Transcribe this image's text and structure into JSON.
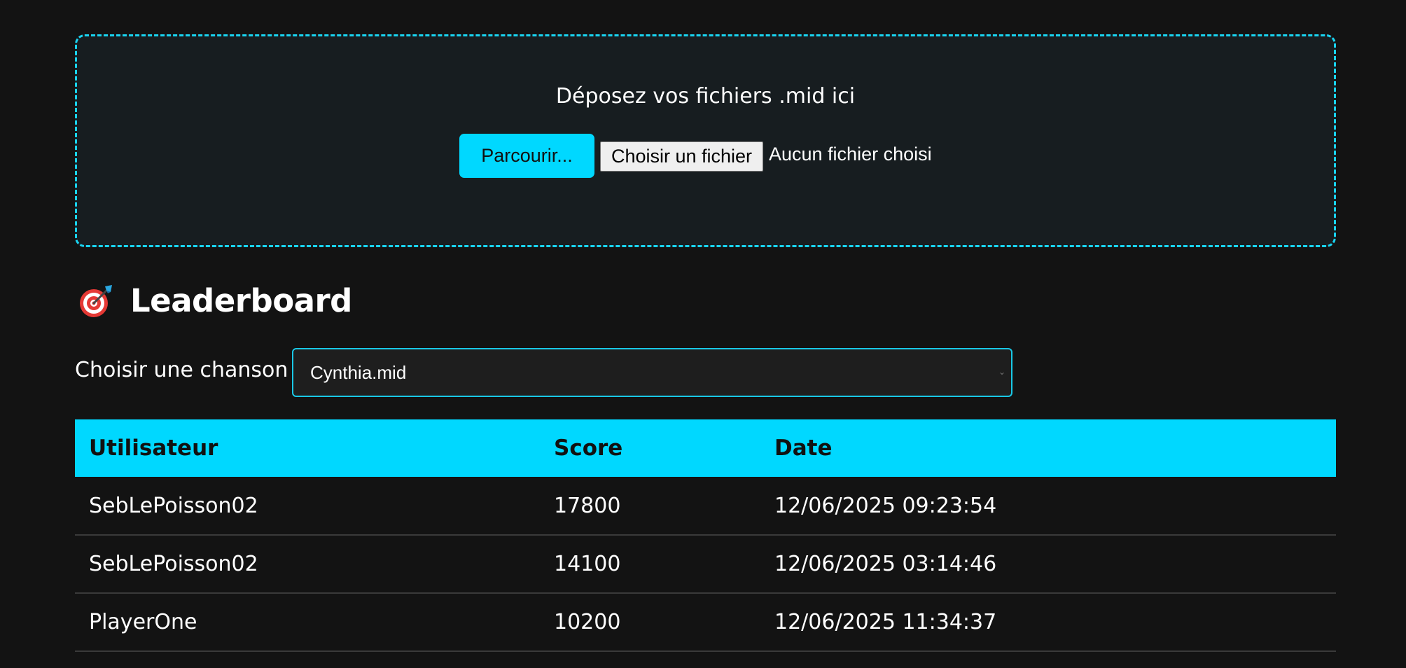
{
  "upload": {
    "title": "Déposez vos fichiers .mid ici",
    "browse_label": "Parcourir...",
    "file_button_label": "Choisir un fichier",
    "file_status": "Aucun fichier choisi"
  },
  "leaderboard": {
    "icon": "target-dart-icon",
    "heading": "Leaderboard",
    "song_label": "Choisir une chanson :",
    "selected_song": "Cynthia.mid",
    "columns": [
      "Utilisateur",
      "Score",
      "Date"
    ],
    "rows": [
      {
        "user": "SebLePoisson02",
        "score": "17800",
        "date": "12/06/2025 09:23:54"
      },
      {
        "user": "SebLePoisson02",
        "score": "14100",
        "date": "12/06/2025 03:14:46"
      },
      {
        "user": "PlayerOne",
        "score": "10200",
        "date": "12/06/2025 11:34:37"
      }
    ]
  },
  "colors": {
    "accent": "#00d8ff",
    "background": "#131313",
    "panel": "#171d20"
  }
}
